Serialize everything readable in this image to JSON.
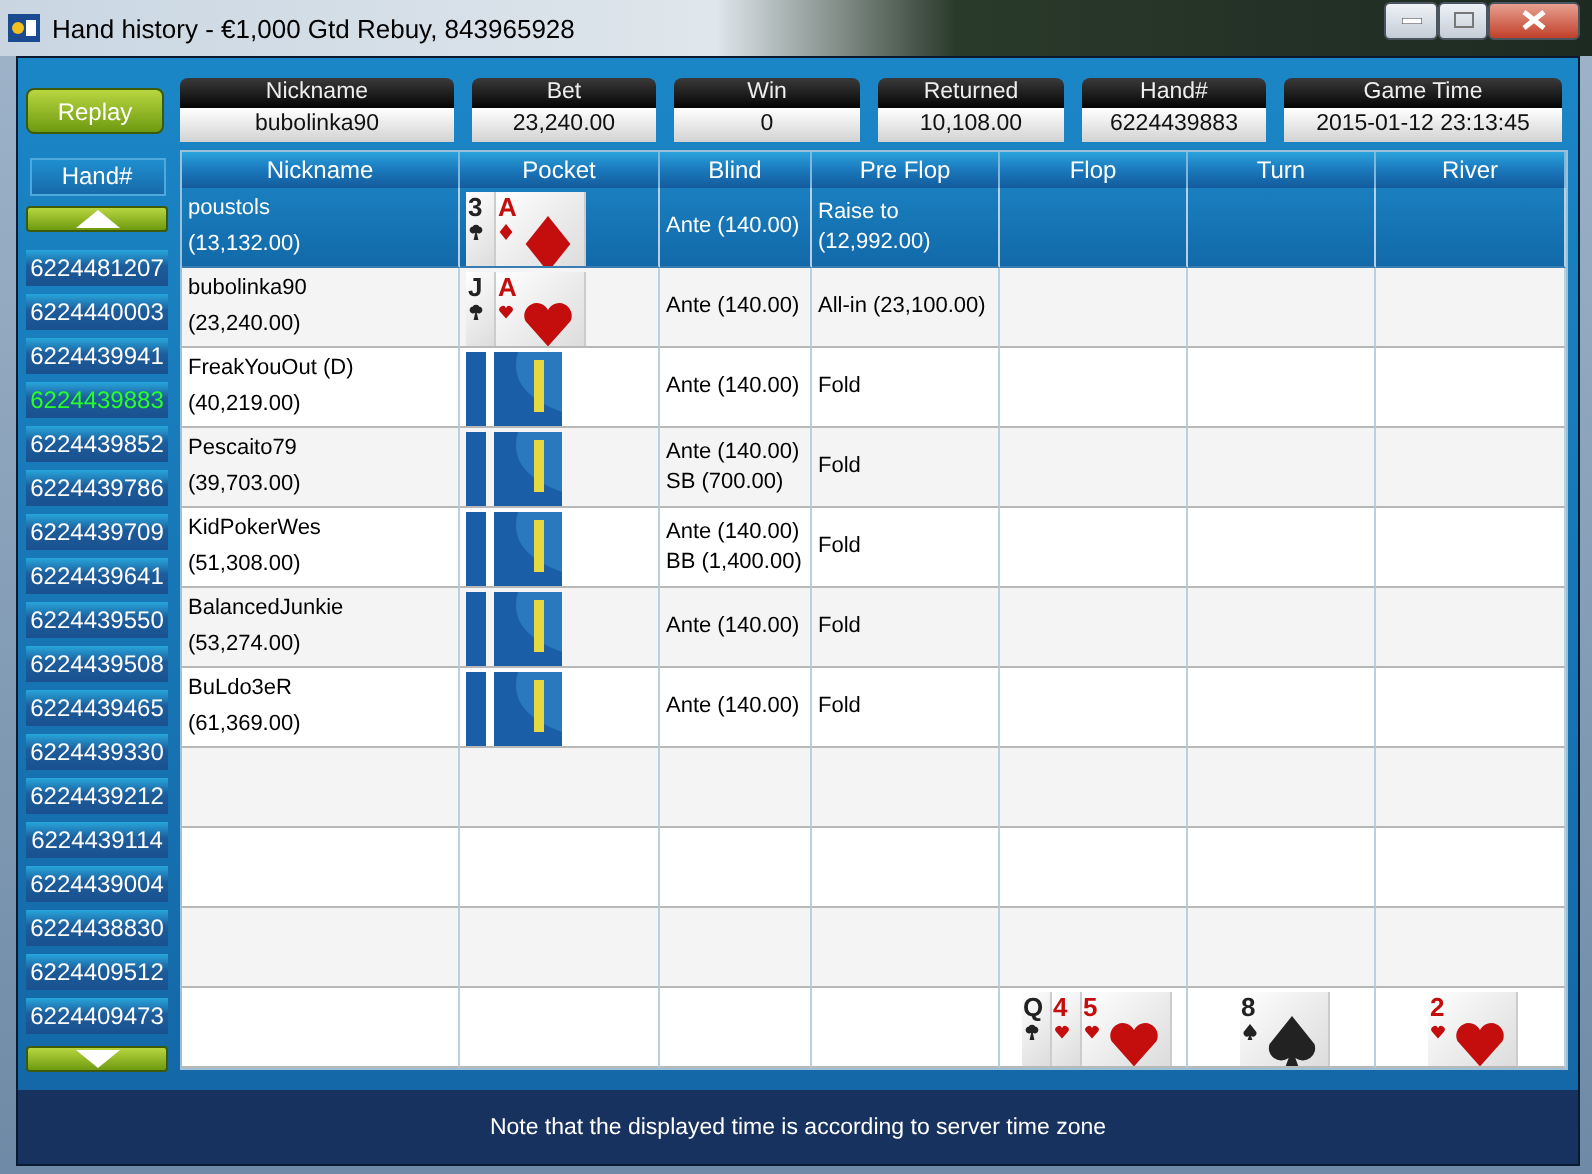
{
  "window": {
    "title": "Hand history - €1,000 Gtd Rebuy, 843965928"
  },
  "replay_button": "Replay",
  "summary": [
    {
      "label": "Nickname",
      "value": "bubolinka90"
    },
    {
      "label": "Bet",
      "value": "23,240.00"
    },
    {
      "label": "Win",
      "value": "0"
    },
    {
      "label": "Returned",
      "value": "10,108.00"
    },
    {
      "label": "Hand#",
      "value": "6224439883"
    },
    {
      "label": "Game Time",
      "value": "2015-01-12 23:13:45"
    }
  ],
  "hand_list": {
    "header": "Hand#",
    "items": [
      {
        "label": "6224481207",
        "selected": false
      },
      {
        "label": "6224440003",
        "selected": false
      },
      {
        "label": "6224439941",
        "selected": false
      },
      {
        "label": "6224439883",
        "selected": true
      },
      {
        "label": "6224439852",
        "selected": false
      },
      {
        "label": "6224439786",
        "selected": false
      },
      {
        "label": "6224439709",
        "selected": false
      },
      {
        "label": "6224439641",
        "selected": false
      },
      {
        "label": "6224439550",
        "selected": false
      },
      {
        "label": "6224439508",
        "selected": false
      },
      {
        "label": "6224439465",
        "selected": false
      },
      {
        "label": "6224439330",
        "selected": false
      },
      {
        "label": "6224439212",
        "selected": false
      },
      {
        "label": "6224439114",
        "selected": false
      },
      {
        "label": "6224439004",
        "selected": false
      },
      {
        "label": "6224438830",
        "selected": false
      },
      {
        "label": "6224409512",
        "selected": false
      },
      {
        "label": "6224409473",
        "selected": false
      }
    ]
  },
  "table": {
    "columns": [
      "Nickname",
      "Pocket",
      "Blind",
      "Pre Flop",
      "Flop",
      "Turn",
      "River"
    ],
    "rows": [
      {
        "nickname": "poustols",
        "stack": "(13,132.00)",
        "selected": true,
        "pocket": [
          {
            "kind": "clubs",
            "rank": "3"
          },
          {
            "kind": "diamonds",
            "rank": "A"
          }
        ],
        "blind": [
          "Ante (140.00)"
        ],
        "pre_flop": "Raise to (12,992.00)"
      },
      {
        "nickname": "bubolinka90",
        "stack": "(23,240.00)",
        "selected": false,
        "pocket": [
          {
            "kind": "clubs",
            "rank": "J"
          },
          {
            "kind": "hearts",
            "rank": "A"
          }
        ],
        "blind": [
          "Ante (140.00)"
        ],
        "pre_flop": "All-in (23,100.00)"
      },
      {
        "nickname": "FreakYouOut (D)",
        "stack": "(40,219.00)",
        "selected": false,
        "pocket": [
          {
            "kind": "back"
          },
          {
            "kind": "back"
          }
        ],
        "blind": [
          "Ante (140.00)"
        ],
        "pre_flop": "Fold"
      },
      {
        "nickname": "Pescaito79",
        "stack": "(39,703.00)",
        "selected": false,
        "pocket": [
          {
            "kind": "back"
          },
          {
            "kind": "back"
          }
        ],
        "blind": [
          "Ante (140.00)",
          "SB (700.00)"
        ],
        "pre_flop": "Fold"
      },
      {
        "nickname": "KidPokerWes",
        "stack": "(51,308.00)",
        "selected": false,
        "pocket": [
          {
            "kind": "back"
          },
          {
            "kind": "back"
          }
        ],
        "blind": [
          "Ante (140.00)",
          "BB (1,400.00)"
        ],
        "pre_flop": "Fold"
      },
      {
        "nickname": "BalancedJunkie",
        "stack": "(53,274.00)",
        "selected": false,
        "pocket": [
          {
            "kind": "back"
          },
          {
            "kind": "back"
          }
        ],
        "blind": [
          "Ante (140.00)"
        ],
        "pre_flop": "Fold"
      },
      {
        "nickname": "BuLdo3eR",
        "stack": "(61,369.00)",
        "selected": false,
        "pocket": [
          {
            "kind": "back"
          },
          {
            "kind": "back"
          }
        ],
        "blind": [
          "Ante (140.00)"
        ],
        "pre_flop": "Fold"
      }
    ],
    "board": {
      "flop": [
        {
          "kind": "clubs",
          "rank": "Q"
        },
        {
          "kind": "hearts",
          "rank": "4"
        },
        {
          "kind": "hearts",
          "rank": "5"
        }
      ],
      "turn": [
        {
          "kind": "spades",
          "rank": "8"
        }
      ],
      "river": [
        {
          "kind": "hearts",
          "rank": "2"
        }
      ]
    }
  },
  "footer_note": "Note that the displayed time is according to server time zone"
}
